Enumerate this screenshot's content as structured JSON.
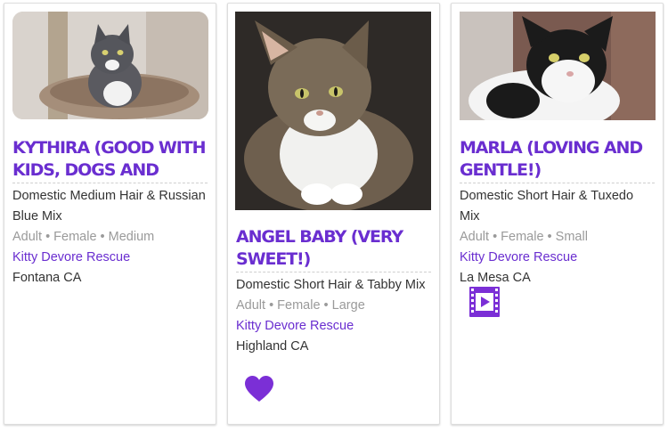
{
  "pets": [
    {
      "name": "KYTHIRA (GOOD WITH KIDS, DOGS AND",
      "breed": "Domestic Medium Hair & Russian Blue Mix",
      "attributes": "Adult • Female • Medium",
      "organization": "Kitty Devore Rescue",
      "location": "Fontana CA",
      "photo": "gray-white-longhair-cat-on-cat-tree"
    },
    {
      "name": "ANGEL BABY (VERY SWEET!)",
      "breed": "Domestic Short Hair & Tabby Mix",
      "attributes": "Adult • Female • Large",
      "organization": "Kitty Devore Rescue",
      "location": "Highland CA",
      "photo": "tabby-white-cat-lying",
      "badge_icon": "heart-icon"
    },
    {
      "name": "MARLA (LOVING AND GENTLE!)",
      "breed": "Domestic Short Hair & Tuxedo Mix",
      "attributes": "Adult • Female • Small",
      "organization": "Kitty Devore Rescue",
      "location": "La Mesa CA",
      "photo": "black-white-tuxedo-cat",
      "badge_icon": "video-icon"
    }
  ],
  "colors": {
    "accent": "#6a2ed0",
    "text": "#333333",
    "muted": "#9a9a9a",
    "border": "#dddddd"
  }
}
